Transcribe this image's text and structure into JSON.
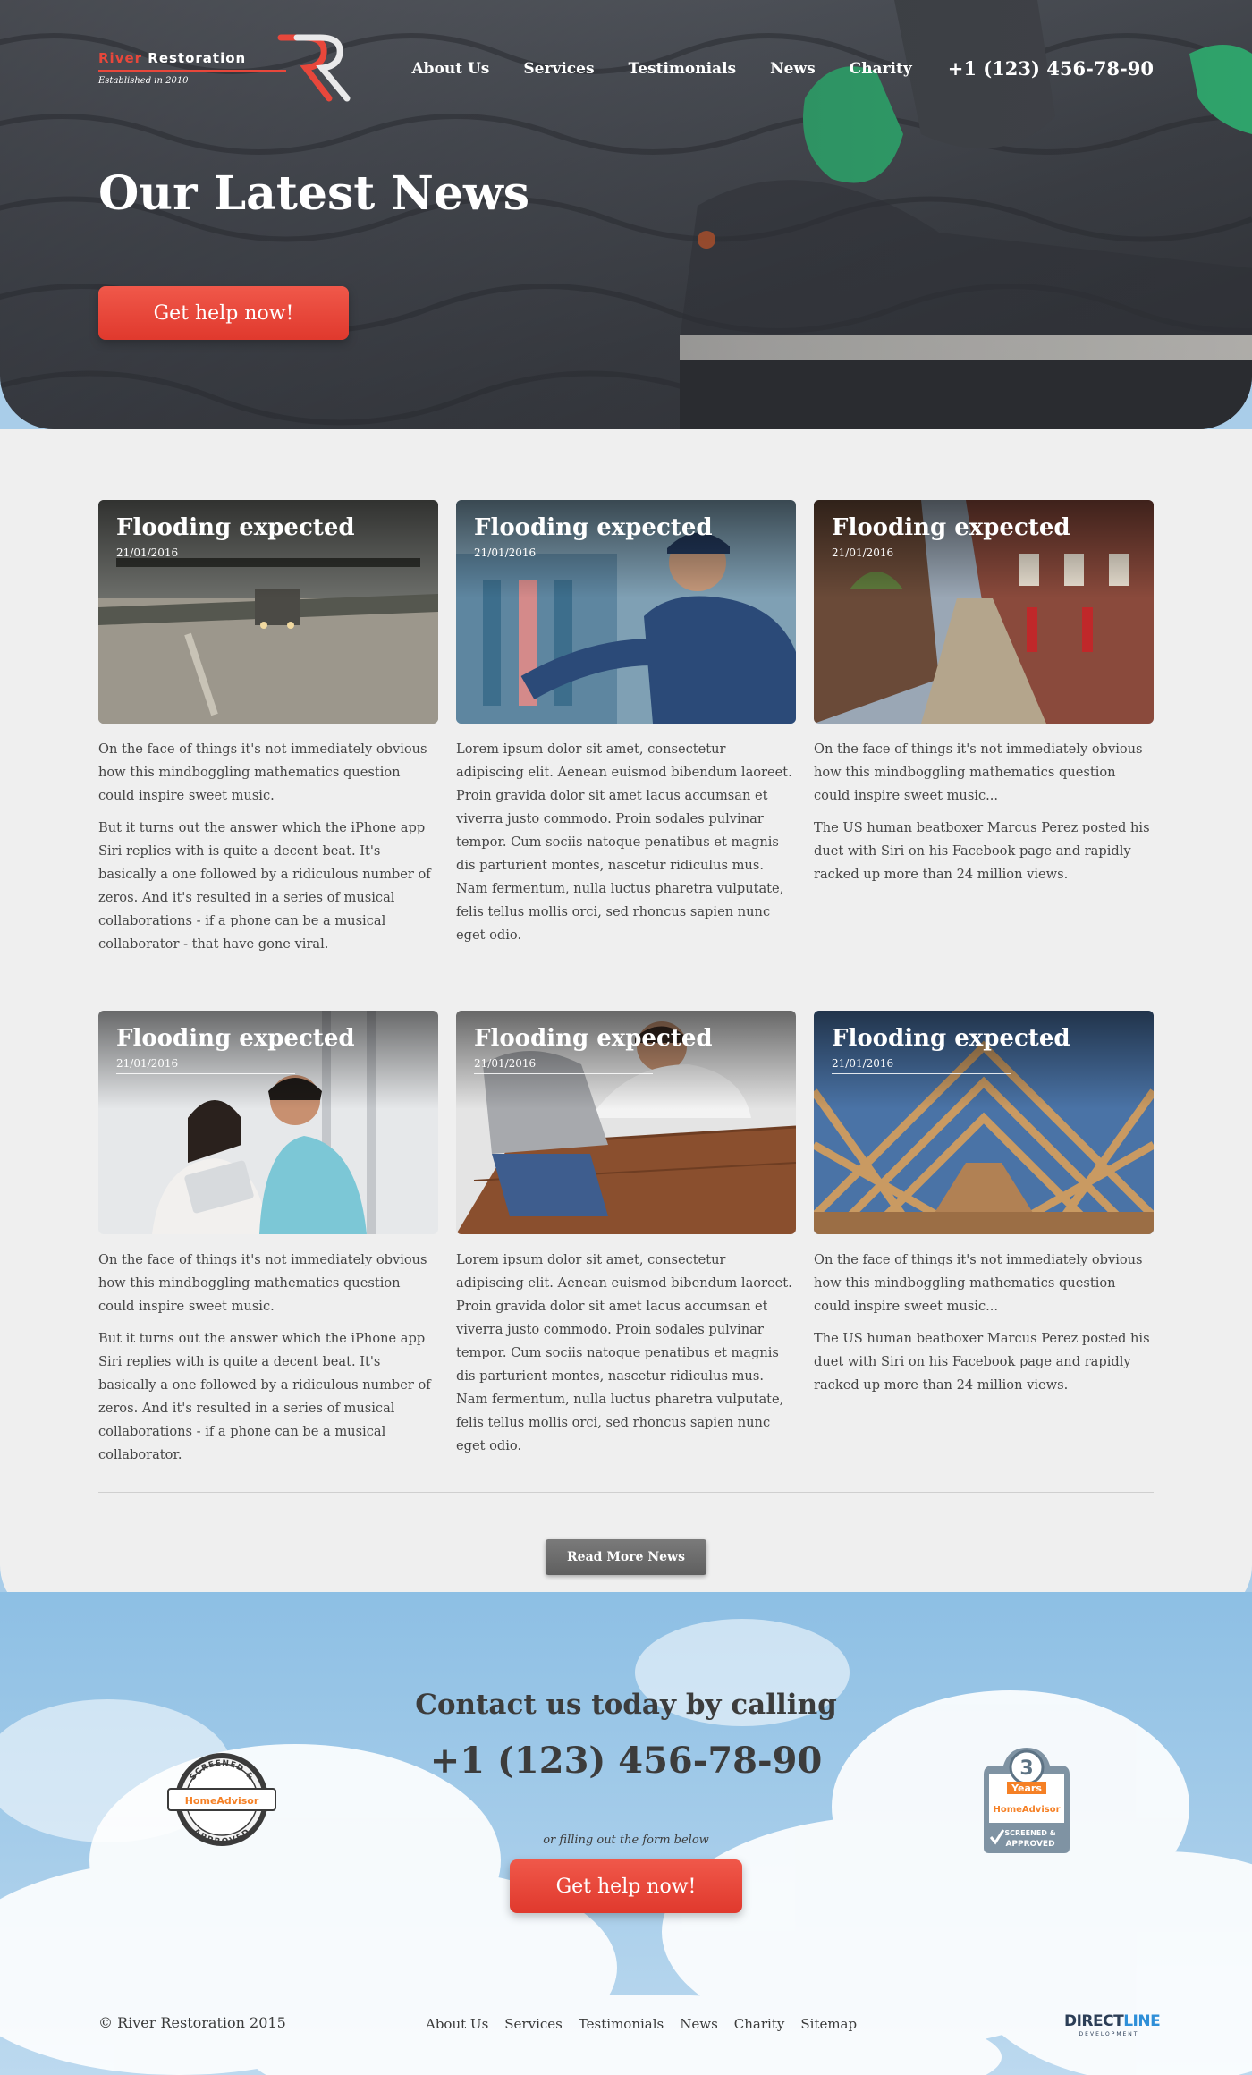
{
  "brand": {
    "name_first": "River",
    "name_second": "Restoration",
    "tagline": "Established in 2010",
    "accent": "#e8473b"
  },
  "nav": {
    "items": [
      "About Us",
      "Services",
      "Testimonials",
      "News",
      "Charity"
    ],
    "phone": "+1 (123) 456-78-90"
  },
  "hero": {
    "title": "Our Latest News",
    "cta": "Get help now!"
  },
  "news": [
    {
      "title": "Flooding expected",
      "date": "21/01/2016",
      "image": "flooded-road",
      "paragraphs": [
        "On the face of things it's not immediately obvious how this mindboggling mathematics question could inspire sweet music.",
        "But it turns out the answer which the iPhone app Siri replies with is quite a decent beat. It's basically a one followed by a ridiculous number of zeros. And it's resulted in a series of musical collaborations - if a phone can be a musical collaborator - that have gone viral."
      ]
    },
    {
      "title": "Flooding expected",
      "date": "21/01/2016",
      "image": "technician",
      "paragraphs": [
        "Lorem ipsum dolor sit amet, consectetur adipiscing elit. Aenean euismod bibendum laoreet. Proin gravida dolor sit amet lacus accumsan et viverra justo commodo. Proin sodales pulvinar tempor. Cum sociis natoque penatibus et magnis dis parturient montes, nascetur ridiculus mus. Nam fermentum, nulla luctus pharetra vulputate, felis tellus mollis orci, sed rhoncus sapien nunc eget odio."
      ]
    },
    {
      "title": "Flooding expected",
      "date": "21/01/2016",
      "image": "brick-street",
      "paragraphs": [
        "On the face of things it's not immediately obvious how this mindboggling mathematics question could inspire sweet music...",
        "The US human beatboxer Marcus Perez posted his duet with Siri on his Facebook page and rapidly racked up more than 24 million views."
      ]
    },
    {
      "title": "Flooding expected",
      "date": "21/01/2016",
      "image": "couple-tablet",
      "paragraphs": [
        "On the face of things it's not immediately obvious how this mindboggling mathematics question could inspire sweet music.",
        "But it turns out the answer which the iPhone app Siri replies with is quite a decent beat. It's basically a one followed by a ridiculous number of zeros. And it's resulted in a series of musical collaborations - if a phone can be a musical collaborator."
      ]
    },
    {
      "title": "Flooding expected",
      "date": "21/01/2016",
      "image": "floor-workers",
      "paragraphs": [
        "Lorem ipsum dolor sit amet, consectetur adipiscing elit. Aenean euismod bibendum laoreet. Proin gravida dolor sit amet lacus accumsan et viverra justo commodo. Proin sodales pulvinar tempor. Cum sociis natoque penatibus et magnis dis parturient montes, nascetur ridiculus mus. Nam fermentum, nulla luctus pharetra vulputate, felis tellus mollis orci, sed rhoncus sapien nunc eget odio."
      ]
    },
    {
      "title": "Flooding expected",
      "date": "21/01/2016",
      "image": "roof-trusses",
      "paragraphs": [
        "On the face of things it's not immediately obvious how this mindboggling mathematics question could inspire sweet music...",
        "The US human beatboxer Marcus Perez posted his duet with Siri on his Facebook page and rapidly racked up more than 24 million views."
      ]
    }
  ],
  "read_more": "Read More News",
  "contact": {
    "title": "Contact us today by calling",
    "phone": "+1 (123) 456-78-90",
    "subtitle": "or filling out the form below",
    "cta": "Get help now!"
  },
  "badges": {
    "left": {
      "top": "SCREENED &",
      "brand": "HomeAdvisor",
      "bottom": "APPROVED"
    },
    "right": {
      "number": "3",
      "unit": "Years",
      "brand": "HomeAdvisor",
      "line1": "SCREENED &",
      "line2": "APPROVED"
    }
  },
  "footer": {
    "copyright": "© River Restoration 2015",
    "links": [
      "About Us",
      "Services",
      "Testimonials",
      "News",
      "Charity",
      "Sitemap"
    ],
    "credit_a": "DIRECT",
    "credit_b": "LINE",
    "credit_sub": "DEVELOPMENT"
  }
}
